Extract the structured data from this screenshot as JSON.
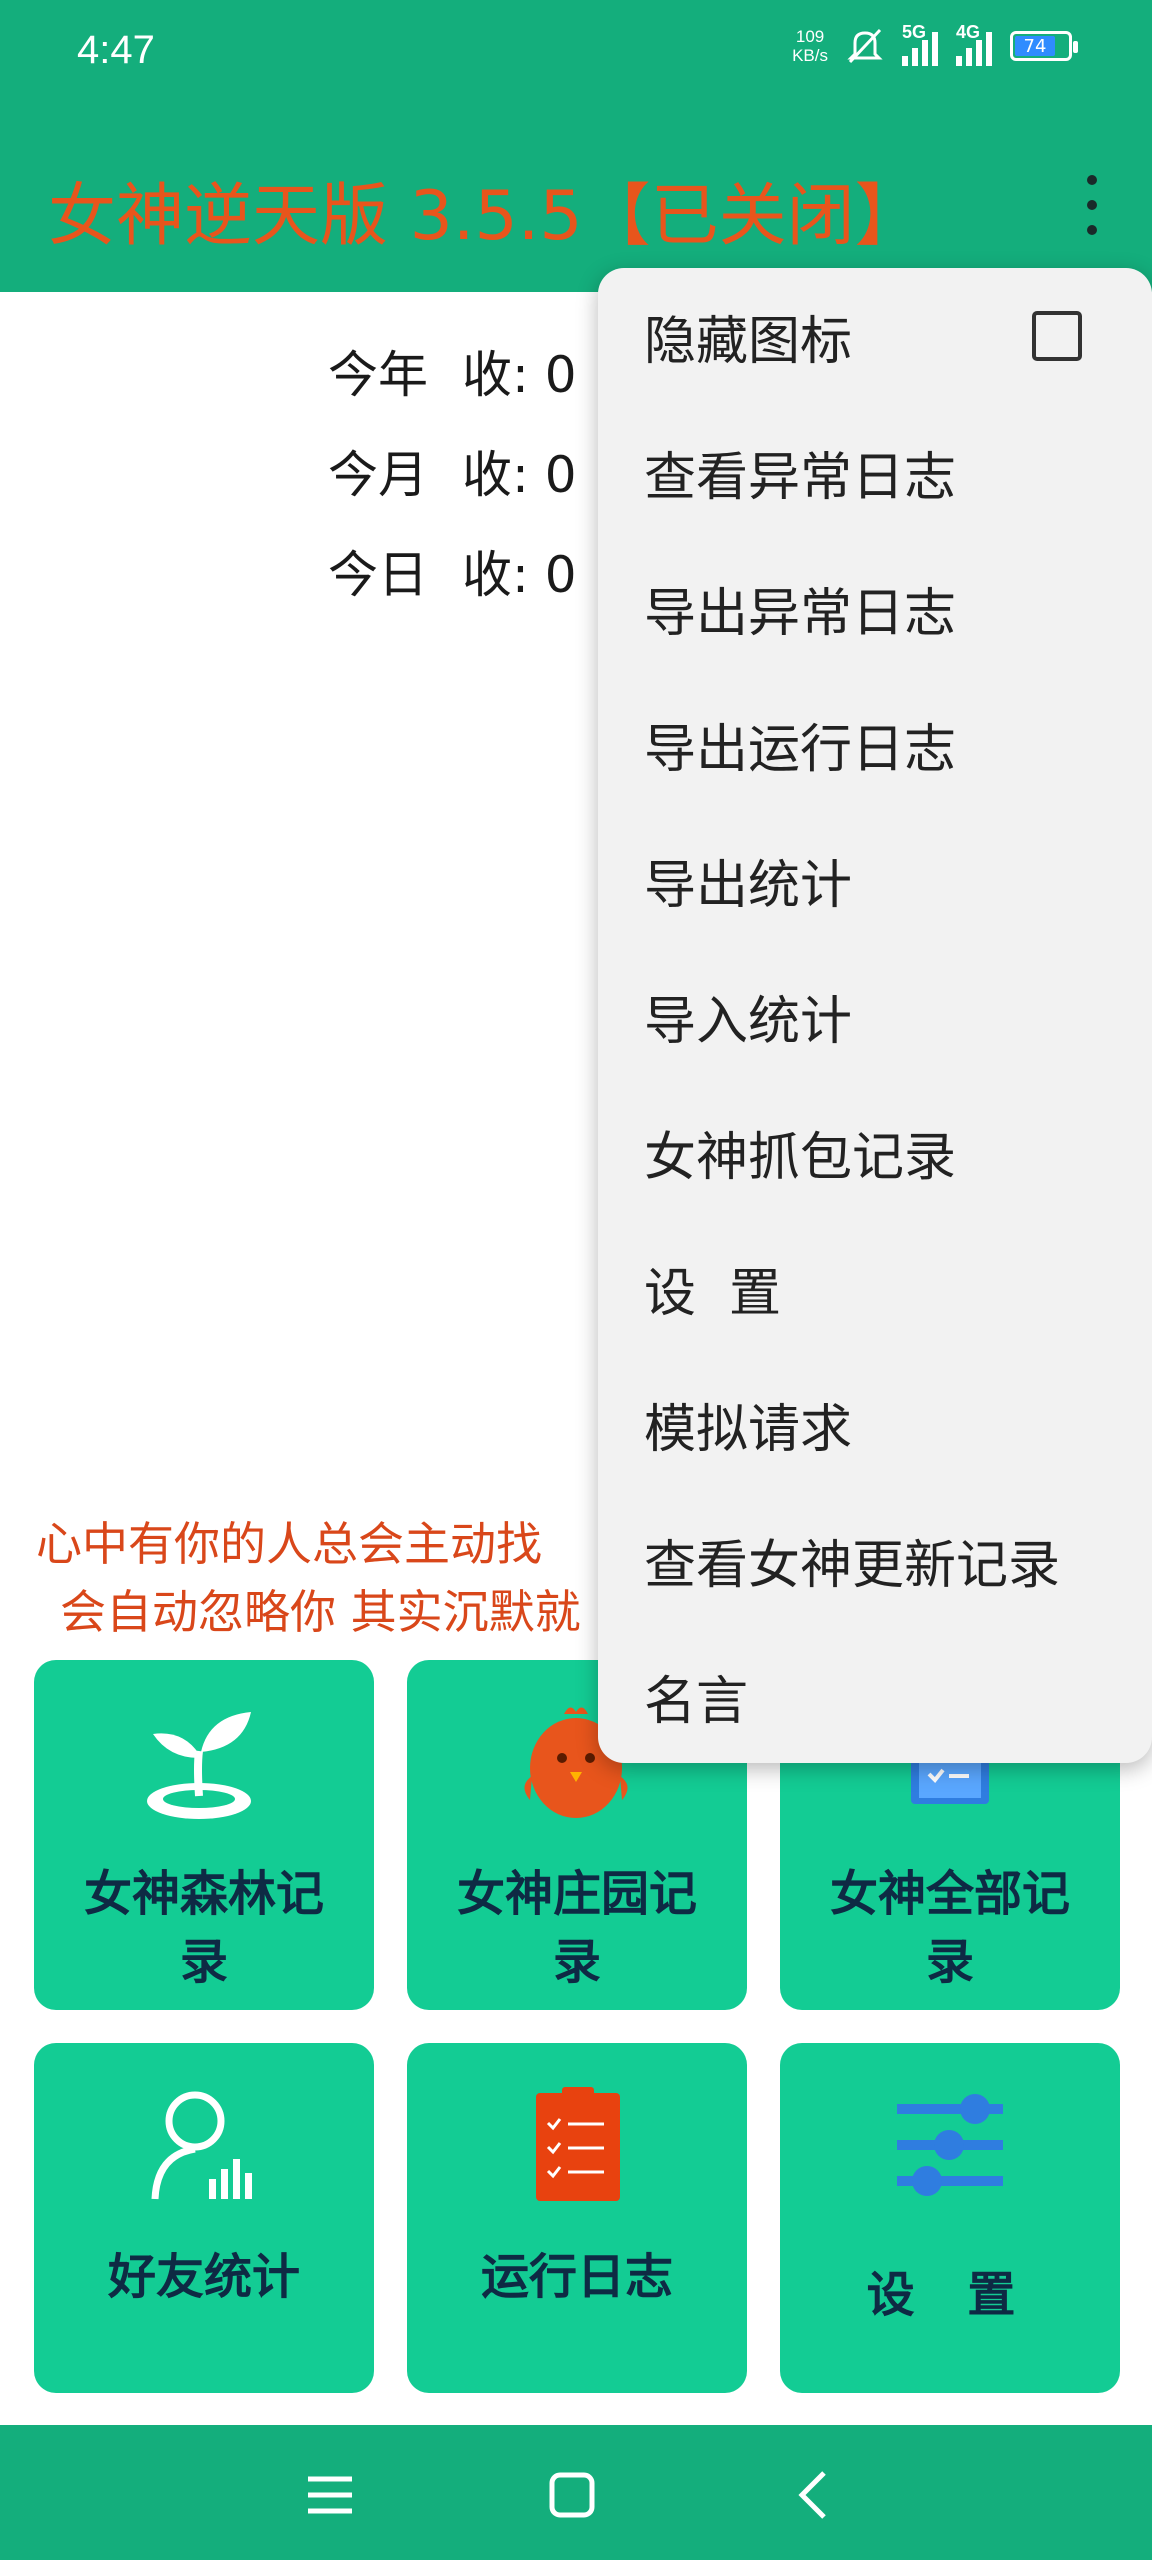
{
  "status_bar": {
    "time": "4:47",
    "net_speed_value": "109",
    "net_speed_unit": "KB/s",
    "signal1_label": "5G",
    "signal2_label": "4G",
    "battery": "74"
  },
  "app_bar": {
    "title": "女神逆天版 3.5.5【已关闭】",
    "title_color": "#e8551c",
    "background": "#14ae7c"
  },
  "stats": [
    {
      "label": "今年",
      "value": "收: 0 "
    },
    {
      "label": "今月",
      "value": "收: 0 "
    },
    {
      "label": "今日",
      "value": "收: 0 "
    }
  ],
  "quote": {
    "line1": "心中有你的人总会主动找",
    "line2": "会自动忽略你 其实沉默就"
  },
  "tiles": [
    {
      "label": "女神森林记录",
      "icon": "sprout-icon"
    },
    {
      "label": "女神庄园记录",
      "icon": "chick-icon"
    },
    {
      "label": "女神全部记录",
      "icon": "clipboard-icon"
    },
    {
      "label": "好友统计",
      "icon": "user-stats-icon"
    },
    {
      "label": "运行日志",
      "icon": "checklist-icon"
    },
    {
      "label": "设 置",
      "icon": "sliders-icon"
    }
  ],
  "menu": {
    "items": [
      {
        "label": "隐藏图标",
        "checkbox": true,
        "checked": false
      },
      {
        "label": "查看异常日志"
      },
      {
        "label": "导出异常日志"
      },
      {
        "label": "导出运行日志"
      },
      {
        "label": "导出统计"
      },
      {
        "label": "导入统计"
      },
      {
        "label": "女神抓包记录"
      },
      {
        "label": "设  置"
      },
      {
        "label": "模拟请求"
      },
      {
        "label": "查看女神更新记录"
      },
      {
        "label": "名言"
      }
    ]
  },
  "nav": {
    "recent": "menu-icon",
    "home": "home-square-icon",
    "back": "back-chevron-icon"
  }
}
